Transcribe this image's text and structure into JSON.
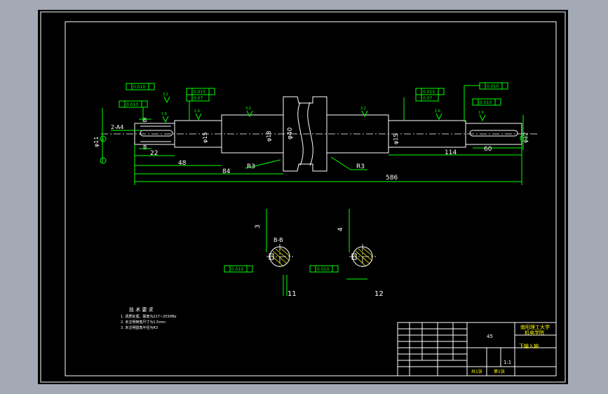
{
  "drawing": {
    "dimensions": {
      "d586": "586",
      "d114": "114",
      "d84": "84",
      "d48": "48",
      "d22": "22",
      "d60": "60",
      "r3_left": "R3",
      "r3_right": "R3",
      "phi40": "φ40",
      "phi18": "φ18",
      "phi15_left": "φ15",
      "phi15_right": "φ15",
      "phi11": "φ11",
      "phi12": "φ12",
      "chamfer": "2-A4",
      "sec_bb_label": "B-B",
      "sec_b_left": "B",
      "sec_b_left2": "B",
      "key_depth_left": "3",
      "key_depth_right": "4",
      "sec_left_dim": "11",
      "sec_right_dim": "12",
      "datum_a": "A",
      "datum_c": "C"
    },
    "tolerances": {
      "t1": "0.010",
      "t2": "0.010",
      "t3": "0.015",
      "t4": "0.07",
      "t5": "0.015",
      "t6": "0.07",
      "t7": "0.010",
      "t8": "0.010",
      "t9": "0.010",
      "t10": "0.010",
      "datum_letter": "A",
      "datum_letter_c": "C",
      "datum_letter_d": "D"
    },
    "roughness": [
      "3.2",
      "1.6",
      "1.6",
      "3.2",
      "3.2",
      "1.6",
      "1.6"
    ],
    "tech_requirements": {
      "title": "技 术 要 求",
      "lines": [
        "1. 调质处理，硬度为217~255HBs",
        "2. 未注明倒角尺寸为1.5mm",
        "3. 未注明圆角半径为R3"
      ]
    },
    "title_block": {
      "material": "45",
      "school": "南阳理工大学",
      "dept": "机电学院",
      "part_name": "下输入轴",
      "scale": "1:1",
      "sheet_info_left": "共1张",
      "sheet_info_right": "第1张"
    }
  },
  "colors": {
    "background": "#a3aab5",
    "sheet": "#000000",
    "line_white": "#ffffff",
    "line_green": "#00ff00",
    "text_yellow": "#ffff00"
  }
}
